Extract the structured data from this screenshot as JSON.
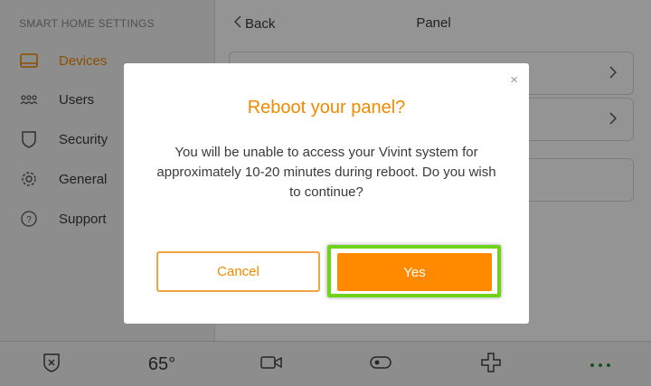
{
  "sidebar": {
    "heading": "SMART HOME SETTINGS",
    "items": [
      {
        "label": "Devices",
        "icon": "tablet-icon",
        "active": true
      },
      {
        "label": "Users",
        "icon": "users-icon"
      },
      {
        "label": "Security",
        "icon": "shield-icon"
      },
      {
        "label": "General",
        "icon": "gear-icon"
      },
      {
        "label": "Support",
        "icon": "question-icon"
      }
    ]
  },
  "header": {
    "back_label": "Back",
    "title": "Panel"
  },
  "bottom_bar": {
    "temperature": "65°",
    "items": [
      "shield-x-icon",
      "thermostat-readout",
      "camera-icon",
      "lock-toggle-icon",
      "plus-cross-icon",
      "more-dots-icon"
    ]
  },
  "dialog": {
    "title": "Reboot your panel?",
    "body": "You will be unable to access your Vivint system for approximately 10-20 minutes during reboot. Do you wish to continue?",
    "cancel_label": "Cancel",
    "confirm_label": "Yes",
    "close_glyph": "×"
  },
  "colors": {
    "accent": "#f08a00",
    "confirm_button": "#ff8a00",
    "highlight": "#6fd31c"
  }
}
